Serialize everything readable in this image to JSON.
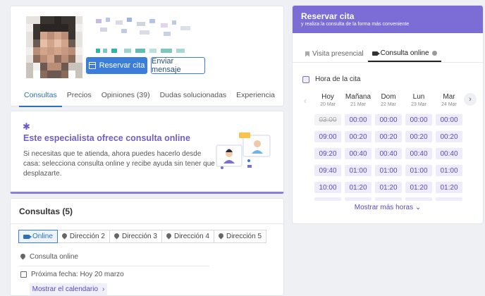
{
  "profile": {
    "reservar_label": "Reservar cita",
    "mensaje_label": "Enviar mensaje",
    "tabs": [
      "Consultas",
      "Precios",
      "Opiniones (39)",
      "Dudas solucionadas",
      "Experiencia"
    ]
  },
  "online": {
    "title": "Este especialista ofrece consulta online",
    "text": "Si necesitas que te atienda, ahora puedes hacerlo desde casa: selecciona consulta online y recibe ayuda sin tener que desplazarte."
  },
  "consultas": {
    "title": "Consultas (5)",
    "addresses": [
      "Online",
      "Dirección 2",
      "Dirección 3",
      "Dirección 4",
      "Dirección 5"
    ],
    "location": "Consulta online",
    "next_date": "Próxima fecha: Hoy 20 marzo",
    "calendar_button": "Mostrar el calendario"
  },
  "booking": {
    "title": "Reservar cita",
    "subtitle": "y realiza la consulta de la forma más conveniente",
    "tab_presencial": "Visita presencial",
    "tab_online": "Consulta online",
    "hora_label": "Hora de la cita",
    "days": [
      {
        "name": "Hoy",
        "date": "20 Mar"
      },
      {
        "name": "Mañana",
        "date": "21 Mar"
      },
      {
        "name": "Dom",
        "date": "22 Mar"
      },
      {
        "name": "Lun",
        "date": "23 Mar"
      },
      {
        "name": "Mar",
        "date": "24 Mar"
      }
    ],
    "slots": [
      [
        "03:00",
        "00:00",
        "00:00",
        "00:00",
        "00:00"
      ],
      [
        "09:00",
        "00:20",
        "00:20",
        "00:20",
        "00:20"
      ],
      [
        "09:20",
        "00:40",
        "00:40",
        "00:40",
        "00:40"
      ],
      [
        "09:40",
        "01:00",
        "01:00",
        "01:00",
        "01:00"
      ],
      [
        "10:00",
        "01:20",
        "01:20",
        "01:20",
        "01:20"
      ]
    ],
    "taken_slot": "03:00",
    "more_label": "Mostrar más horas"
  },
  "colors": {
    "primary": "#3b7dd8",
    "accent": "#7b6cd6"
  }
}
